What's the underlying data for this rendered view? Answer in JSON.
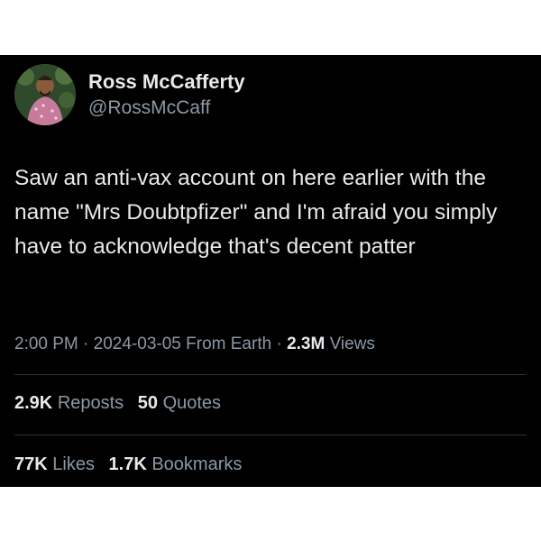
{
  "author": {
    "display_name": "Ross McCafferty",
    "handle": "@RossMcCaff",
    "avatar_icon": "profile-photo"
  },
  "tweet": {
    "text": "Saw an anti-vax account on here earlier with the name \"Mrs Doubtpfizer\" and I'm afraid you simply have to acknowledge that's decent patter"
  },
  "meta": {
    "time": "2:00 PM",
    "date": "2024-03-05",
    "source": "From Earth",
    "separator": "·",
    "views_count": "2.3M",
    "views_label": "Views"
  },
  "stats": {
    "reposts_count": "2.9K",
    "reposts_label": "Reposts",
    "quotes_count": "50",
    "quotes_label": "Quotes",
    "likes_count": "77K",
    "likes_label": "Likes",
    "bookmarks_count": "1.7K",
    "bookmarks_label": "Bookmarks"
  },
  "colors": {
    "background": "#000000",
    "text": "#e7e9ea",
    "secondary_text": "#8b98a5",
    "divider": "#2f3336"
  }
}
